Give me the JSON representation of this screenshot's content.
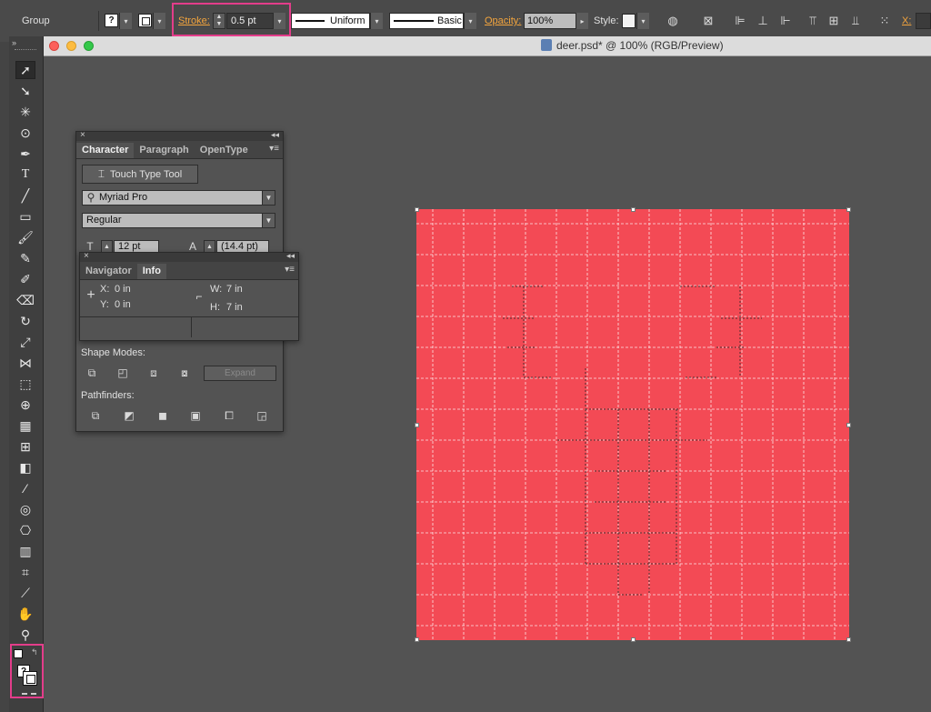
{
  "control_bar": {
    "selection_label": "Group",
    "fill_mark": "?",
    "stroke_label": "Stroke:",
    "stroke_value": "0.5 pt",
    "profile_label": "Uniform",
    "brush_label": "Basic",
    "opacity_label": "Opacity:",
    "opacity_value": "100%",
    "style_label": "Style:",
    "x_label": "X:"
  },
  "document": {
    "title": "deer.psd* @ 100% (RGB/Preview)"
  },
  "character_panel": {
    "tabs": [
      "Character",
      "Paragraph",
      "OpenType"
    ],
    "touch_type_button": "Touch Type Tool",
    "font_family": "Myriad Pro",
    "font_style": "Regular",
    "font_size": "12 pt",
    "leading": "(14.4 pt)"
  },
  "info_panel": {
    "tabs": [
      "Navigator",
      "Info"
    ],
    "x_label": "X:",
    "x_value": "0 in",
    "y_label": "Y:",
    "y_value": "0 in",
    "w_label": "W:",
    "w_value": "7 in",
    "h_label": "H:",
    "h_value": "7 in"
  },
  "pathfinder_panel": {
    "shape_modes_label": "Shape Modes:",
    "expand_button": "Expand",
    "pathfinders_label": "Pathfinders:"
  },
  "toolbox": {
    "fill_stroke_mark": "?"
  },
  "colors": {
    "artboard_fill": "#f34a55",
    "highlight": "#e33d8a",
    "accent_label": "#f4a53d",
    "traffic_close": "#fc605b",
    "traffic_min": "#fdbc40",
    "traffic_max": "#34c84a"
  }
}
